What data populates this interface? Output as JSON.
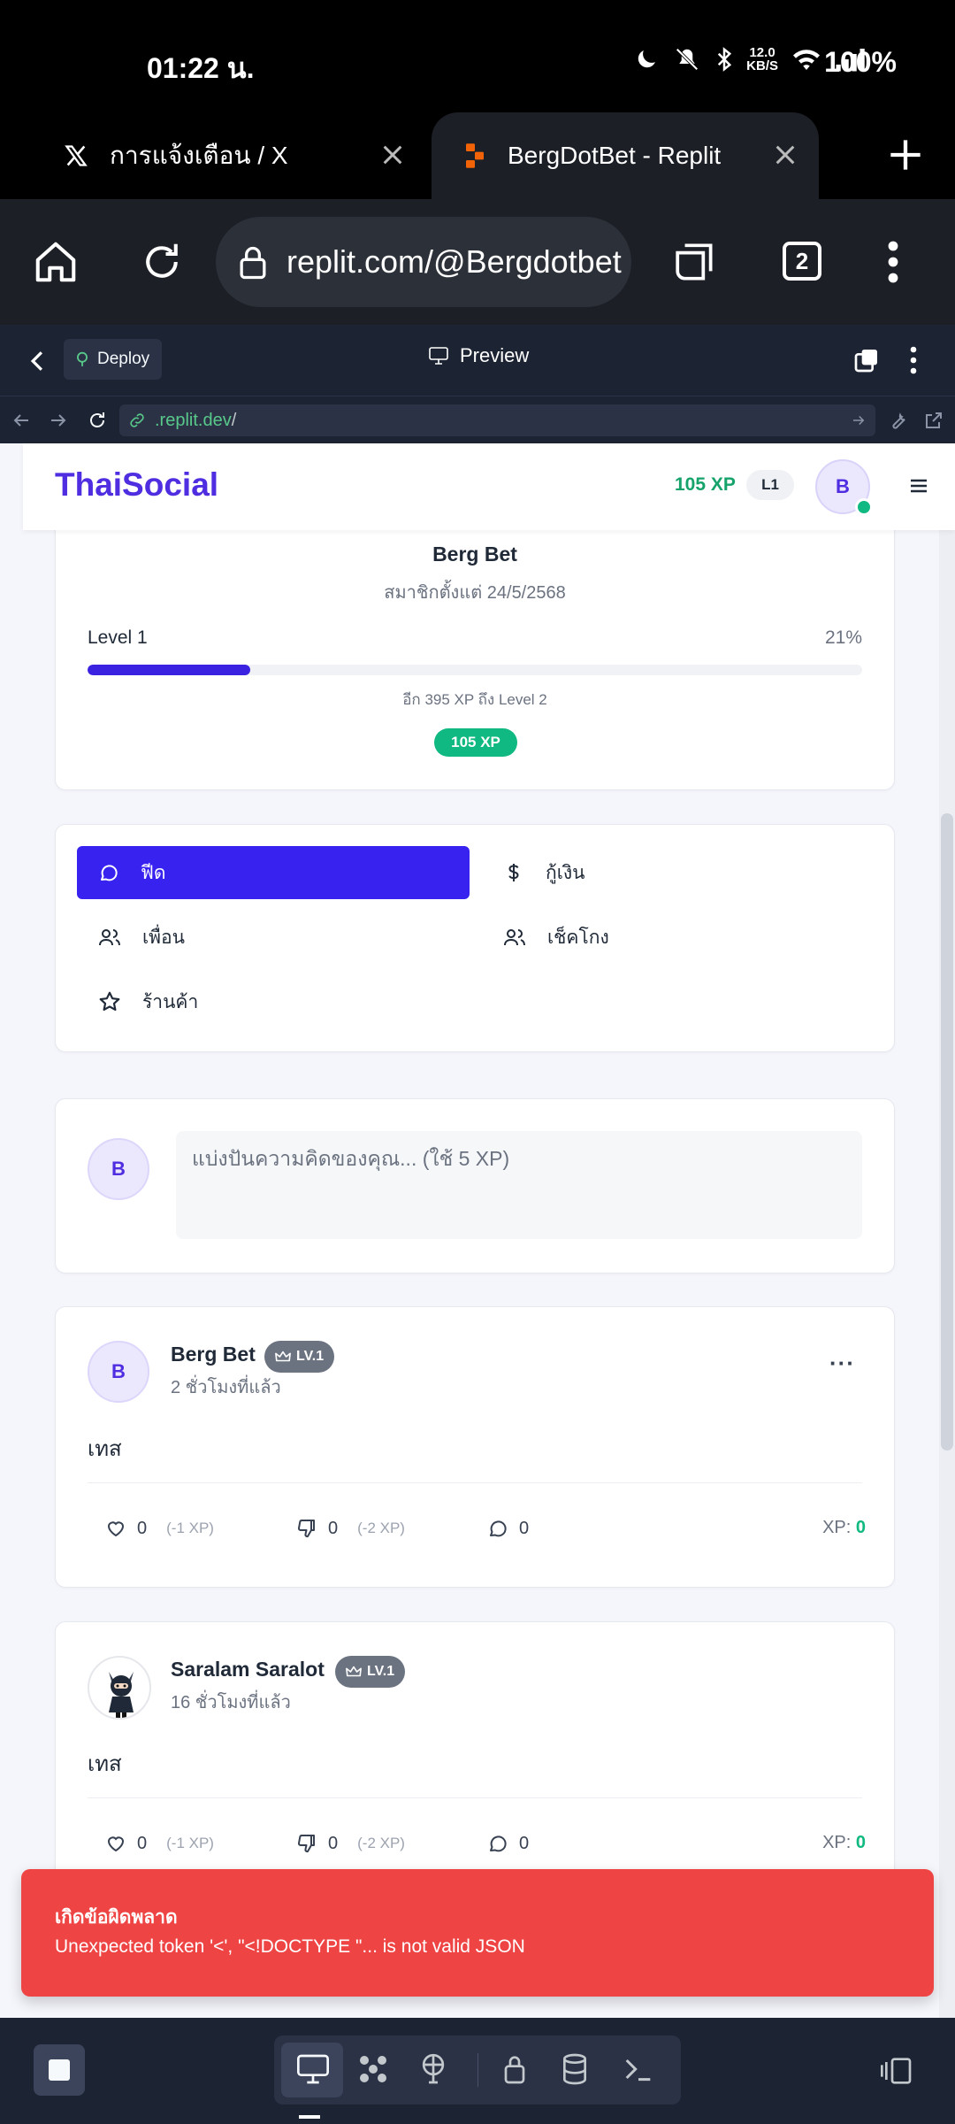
{
  "status_bar": {
    "time": "01:22 น.",
    "net_speed_top": "12.0",
    "net_speed_unit": "KB/S",
    "battery": "100%"
  },
  "browser": {
    "tabs": [
      {
        "title": "การแจ้งเตือน / X",
        "icon": "x-logo-icon"
      },
      {
        "title": "BergDotBet - Replit",
        "icon": "replit-logo-icon"
      }
    ],
    "url": "replit.com/@Bergdotbet",
    "tab_count": "2"
  },
  "replit": {
    "deploy_label": "Deploy",
    "preview_label": "Preview",
    "webview_url_host": ".replit.dev",
    "webview_url_path": "/"
  },
  "app": {
    "brand": "ThaiSocial",
    "nav_xp": "105 XP",
    "nav_level": "L1",
    "avatar_initial": "B",
    "profile": {
      "name": "Berg Bet",
      "member_since": "สมาชิกตั้งแต่ 24/5/2568",
      "level_label": "Level 1",
      "level_percent_label": "21%",
      "level_progress": 0.21,
      "xp_to_next": "อีก 395 XP ถึง Level 2",
      "xp_badge": "105 XP"
    },
    "menu": [
      {
        "label": "ฟีด",
        "icon": "chat-bubble-icon",
        "active": true
      },
      {
        "label": "กู้เงิน",
        "icon": "dollar-icon",
        "active": false
      },
      {
        "label": "เพื่อน",
        "icon": "users-icon",
        "active": false
      },
      {
        "label": "เช็คโกง",
        "icon": "users-check-icon",
        "active": false
      },
      {
        "label": "ร้านค้า",
        "icon": "star-icon",
        "active": false
      }
    ],
    "compose": {
      "placeholder": "แบ่งปันความคิดของคุณ... (ใช้ 5 XP)"
    },
    "posts": [
      {
        "author": "Berg Bet",
        "level_badge": "LV.1",
        "time": "2 ชั่วโมงที่แล้ว",
        "body": "เทส",
        "likes": "0",
        "like_cost": "(-1 XP)",
        "dislikes": "0",
        "dislike_cost": "(-2 XP)",
        "comments": "0",
        "xp_label": "XP:",
        "xp_value": "0"
      },
      {
        "author": "Saralam Saralot",
        "level_badge": "LV.1",
        "time": "16 ชั่วโมงที่แล้ว",
        "body": "เทส",
        "likes": "0",
        "like_cost": "(-1 XP)",
        "dislikes": "0",
        "dislike_cost": "(-2 XP)",
        "comments": "0",
        "xp_label": "XP:",
        "xp_value": "0"
      }
    ],
    "more_label": "···"
  },
  "toast": {
    "title": "เกิดข้อผิดพลาด",
    "message": "Unexpected token '<', \"<!DOCTYPE \"... is not valid JSON",
    "color": "#ef4444"
  },
  "colors": {
    "brand": "#4f2de0",
    "active_menu": "#3722f0",
    "xp_green": "#10b981"
  }
}
